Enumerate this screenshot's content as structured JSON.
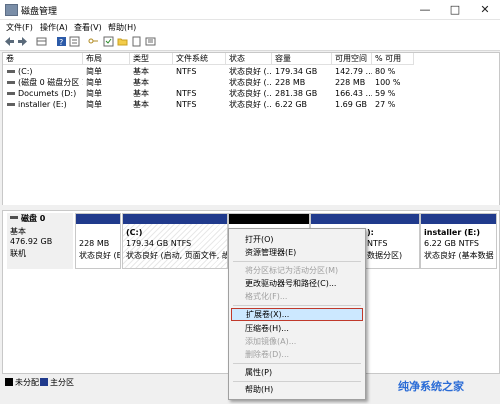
{
  "window": {
    "title": "磁盘管理",
    "controls": [
      "—",
      "□",
      "✕"
    ]
  },
  "menu": [
    "文件(F)",
    "操作(A)",
    "查看(V)",
    "帮助(H)"
  ],
  "toolbar_icons": [
    "back-arrow-icon",
    "forward-arrow-icon",
    "grid-icon",
    "help-icon",
    "properties-icon",
    "key-icon",
    "folder-icon",
    "page-icon",
    "list-icon"
  ],
  "table": {
    "columns": [
      "卷",
      "布局",
      "类型",
      "文件系统",
      "状态",
      "容量",
      "可用空间",
      "% 可用"
    ],
    "rows": [
      [
        "(C:)",
        "简单",
        "基本",
        "NTFS",
        "状态良好 (...",
        "179.34 GB",
        "142.79 ...",
        "80 %"
      ],
      [
        "(磁盘 0 磁盘分区 1)",
        "简单",
        "基本",
        "",
        "状态良好 (...",
        "228 MB",
        "228 MB",
        "100 %"
      ],
      [
        "Documets (D:)",
        "简单",
        "基本",
        "NTFS",
        "状态良好 (...",
        "281.38 GB",
        "166.43 ...",
        "59 %"
      ],
      [
        "installer (E:)",
        "简单",
        "基本",
        "NTFS",
        "状态良好 (...",
        "6.22 GB",
        "1.69 GB",
        "27 %"
      ]
    ]
  },
  "disk": {
    "name": "磁盘 0",
    "type": "基本",
    "size": "476.92 GB",
    "status": "联机",
    "partitions": {
      "p1": {
        "size": "228 MB",
        "status": "状态良好 (E"
      },
      "c": {
        "name": "(C:)",
        "size": "179.34 GB NTFS",
        "status": "状态良好 (启动, 页面文件, 故障"
      },
      "d_partial": {
        "name": "):",
        "size": "NTFS",
        "status": "数据分区)"
      },
      "e": {
        "name": "installer (E:)",
        "size": "6.22 GB NTFS",
        "status": "状态良好 (基本数据"
      }
    }
  },
  "legend": [
    {
      "label": "未分配",
      "color": "#000000"
    },
    {
      "label": "主分区",
      "color": "#203a8c"
    }
  ],
  "context_menu": [
    {
      "label": "打开(O)",
      "enabled": true
    },
    {
      "label": "资源管理器(E)",
      "enabled": true
    },
    {
      "label": "将分区标记为活动分区(M)",
      "enabled": false
    },
    {
      "label": "更改驱动器号和路径(C)...",
      "enabled": true
    },
    {
      "label": "格式化(F)...",
      "enabled": false
    },
    {
      "label": "扩展卷(X)...",
      "enabled": true,
      "highlighted": true
    },
    {
      "label": "压缩卷(H)...",
      "enabled": true
    },
    {
      "label": "添加镜像(A)...",
      "enabled": false
    },
    {
      "label": "删除卷(D)...",
      "enabled": false
    },
    {
      "label": "属性(P)",
      "enabled": true
    },
    {
      "label": "帮助(H)",
      "enabled": true
    }
  ],
  "watermark": "纯净系统之家"
}
